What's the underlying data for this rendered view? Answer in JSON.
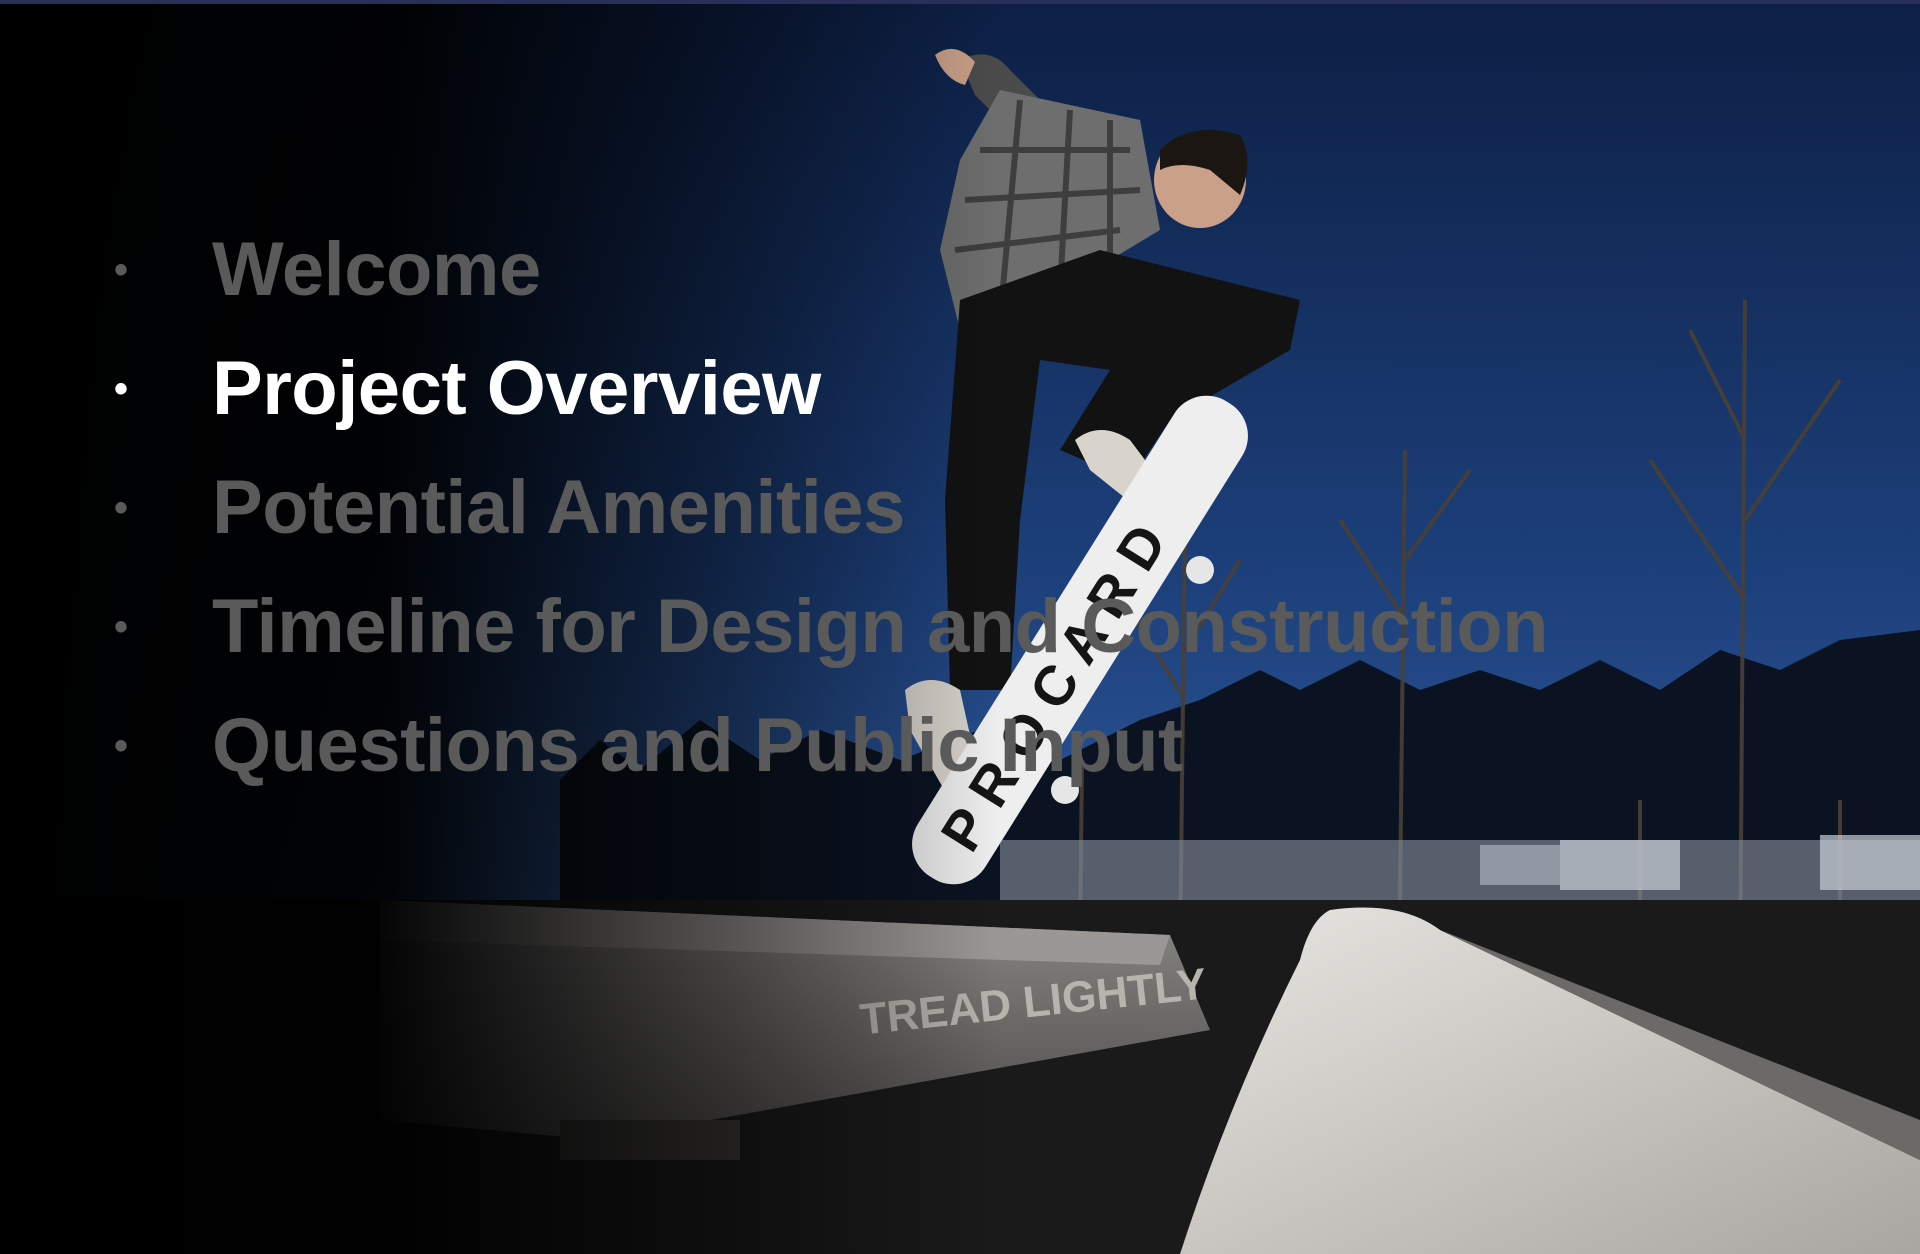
{
  "slide": {
    "agenda": [
      {
        "label": "Welcome",
        "active": false
      },
      {
        "label": "Project Overview",
        "active": true
      },
      {
        "label": "Potential Amenities",
        "active": false
      },
      {
        "label": "Timeline for Design and Construction",
        "active": false
      },
      {
        "label": "Questions and Public Input",
        "active": false
      }
    ],
    "photo": {
      "subject": "skateboarder-photo",
      "concrete_ledge_text": "TREAD LIGHTLY"
    },
    "colors": {
      "active_text": "#ffffff",
      "inactive_text": "#5a5a5a",
      "sky": "#1c3f7a",
      "background": "#000000"
    }
  }
}
